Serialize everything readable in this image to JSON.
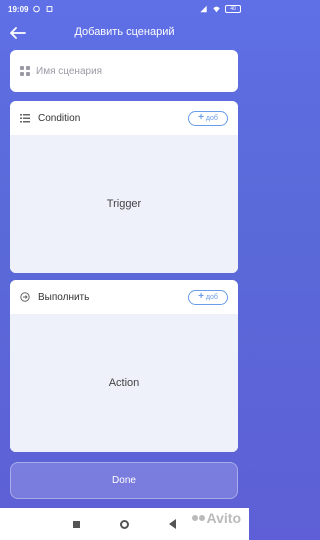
{
  "status": {
    "time": "19:09",
    "battery": "40"
  },
  "header": {
    "title": "Добавить сценарий"
  },
  "name_field": {
    "placeholder": "Имя сценария"
  },
  "condition": {
    "label": "Condition",
    "add_label": "доб",
    "body": "Trigger"
  },
  "action": {
    "label": "Выполнить",
    "add_label": "доб",
    "body": "Action"
  },
  "done": {
    "label": "Done"
  },
  "watermark": {
    "text": "Avito"
  },
  "colors": {
    "accent": "#5f6fe6",
    "add_button": "#6a9de8"
  }
}
